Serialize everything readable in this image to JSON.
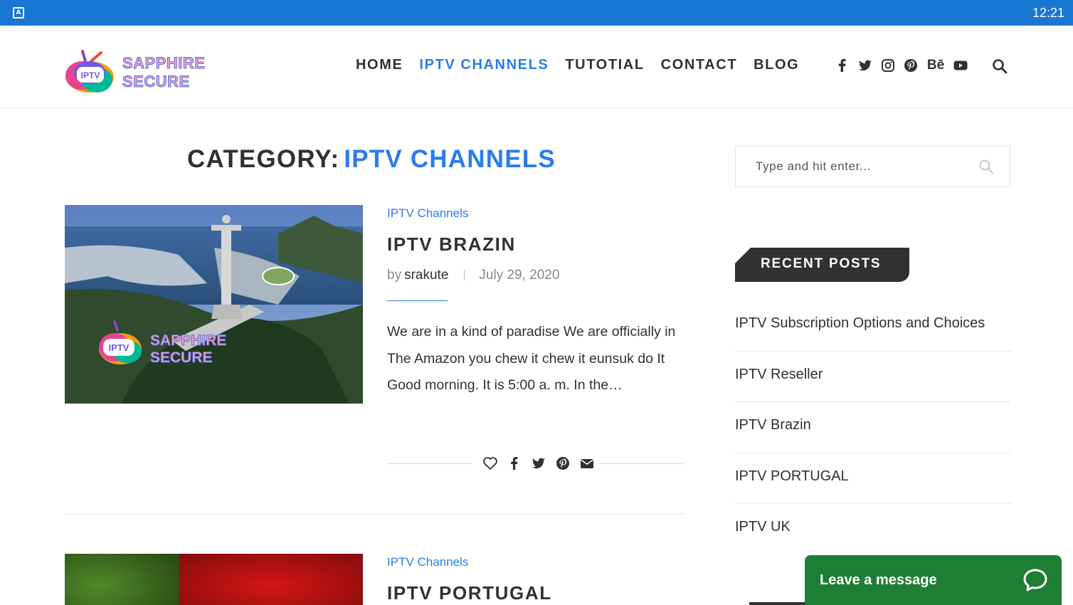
{
  "status_bar": {
    "clock": "12:21",
    "app_icon": "A"
  },
  "logo": {
    "badge": "IPTV",
    "line1": "SAPPHIRE",
    "line2": "SECURE"
  },
  "nav": {
    "items": [
      {
        "label": "HOME",
        "active": false
      },
      {
        "label": "IPTV CHANNELS",
        "active": true
      },
      {
        "label": "TUTOTIAL",
        "active": false
      },
      {
        "label": "CONTACT",
        "active": false
      },
      {
        "label": "BLOG",
        "active": false
      }
    ]
  },
  "social": [
    "facebook-icon",
    "twitter-icon",
    "instagram-icon",
    "pinterest-icon",
    "behance-icon",
    "youtube-icon"
  ],
  "social_behance_text": "Bē",
  "category_heading": {
    "label": "CATEGORY:",
    "name": "IPTV CHANNELS"
  },
  "posts": [
    {
      "category": "IPTV Channels",
      "title": "IPTV BRAZIN",
      "by": "by",
      "author": "srakute",
      "date": "July 29, 2020",
      "excerpt": "We are in a kind of paradise We are officially in The Amazon you chew it chew it eunsuk do It Good morning. It is 5:00 a. m. In the…",
      "thumb_badge": "IPTV",
      "thumb_line1": "SAPPHIRE",
      "thumb_line2": "SECURE"
    },
    {
      "category": "IPTV Channels",
      "title": "IPTV PORTUGAL"
    }
  ],
  "sidebar": {
    "search_placeholder": "Type and hit enter...",
    "recent_title": "RECENT POSTS",
    "recent_posts": [
      "IPTV Subscription Options and Choices",
      "IPTV Reseller",
      "IPTV Brazin",
      "IPTV PORTUGAL",
      "IPTV UK"
    ]
  },
  "chat": {
    "label": "Leave a message"
  },
  "colors": {
    "accent": "#2b7de9",
    "dark": "#313131",
    "status_bar": "#1976d2",
    "chat": "#1e7e34"
  }
}
